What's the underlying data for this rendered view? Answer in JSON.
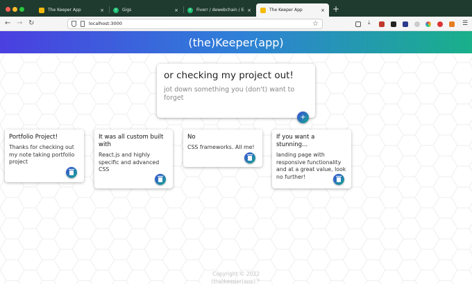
{
  "browser": {
    "tabs": [
      {
        "title": "The Keeper App",
        "active": false,
        "favicon": "keeper-icon"
      },
      {
        "title": "Gigs",
        "active": false,
        "favicon": "fiverr-icon"
      },
      {
        "title": "Fiverr / dewebchain / Edit Gig",
        "active": false,
        "favicon": "fiverr-icon"
      },
      {
        "title": "The Keeper App",
        "active": true,
        "favicon": "keeper-icon"
      }
    ],
    "tab_close_glyph": "×",
    "new_tab_glyph": "+",
    "url": "localhost:3000",
    "fiverr_glyph": "f"
  },
  "app": {
    "title": "(the)Keeper(app)",
    "create_note": {
      "title_value": "or checking my project out!",
      "content_placeholder": "jot down something you (don't) want to forget",
      "add_glyph": "+"
    },
    "notes": [
      {
        "title": "Portfolio Project!",
        "content": "Thanks for checking out my note taking portfolio project"
      },
      {
        "title": "It was all custom built with",
        "content": "React.js and highly specific and advanced CSS"
      },
      {
        "title": "No",
        "content": "CSS frameworks. All me!"
      },
      {
        "title": "If you want a stunning...",
        "content": "landing page with responsive functionality and at a great value, look no further!"
      }
    ],
    "footer": {
      "line1": "Copyright © 2022",
      "line2": "(the)keeper(app)™"
    }
  },
  "colors": {
    "header_gradient": [
      "#4a3fe0",
      "#2f7fd8",
      "#19b08a"
    ],
    "button_gradient": [
      "#3b4fd8",
      "#16a592"
    ],
    "tab_bar": "#1f3a2e"
  }
}
